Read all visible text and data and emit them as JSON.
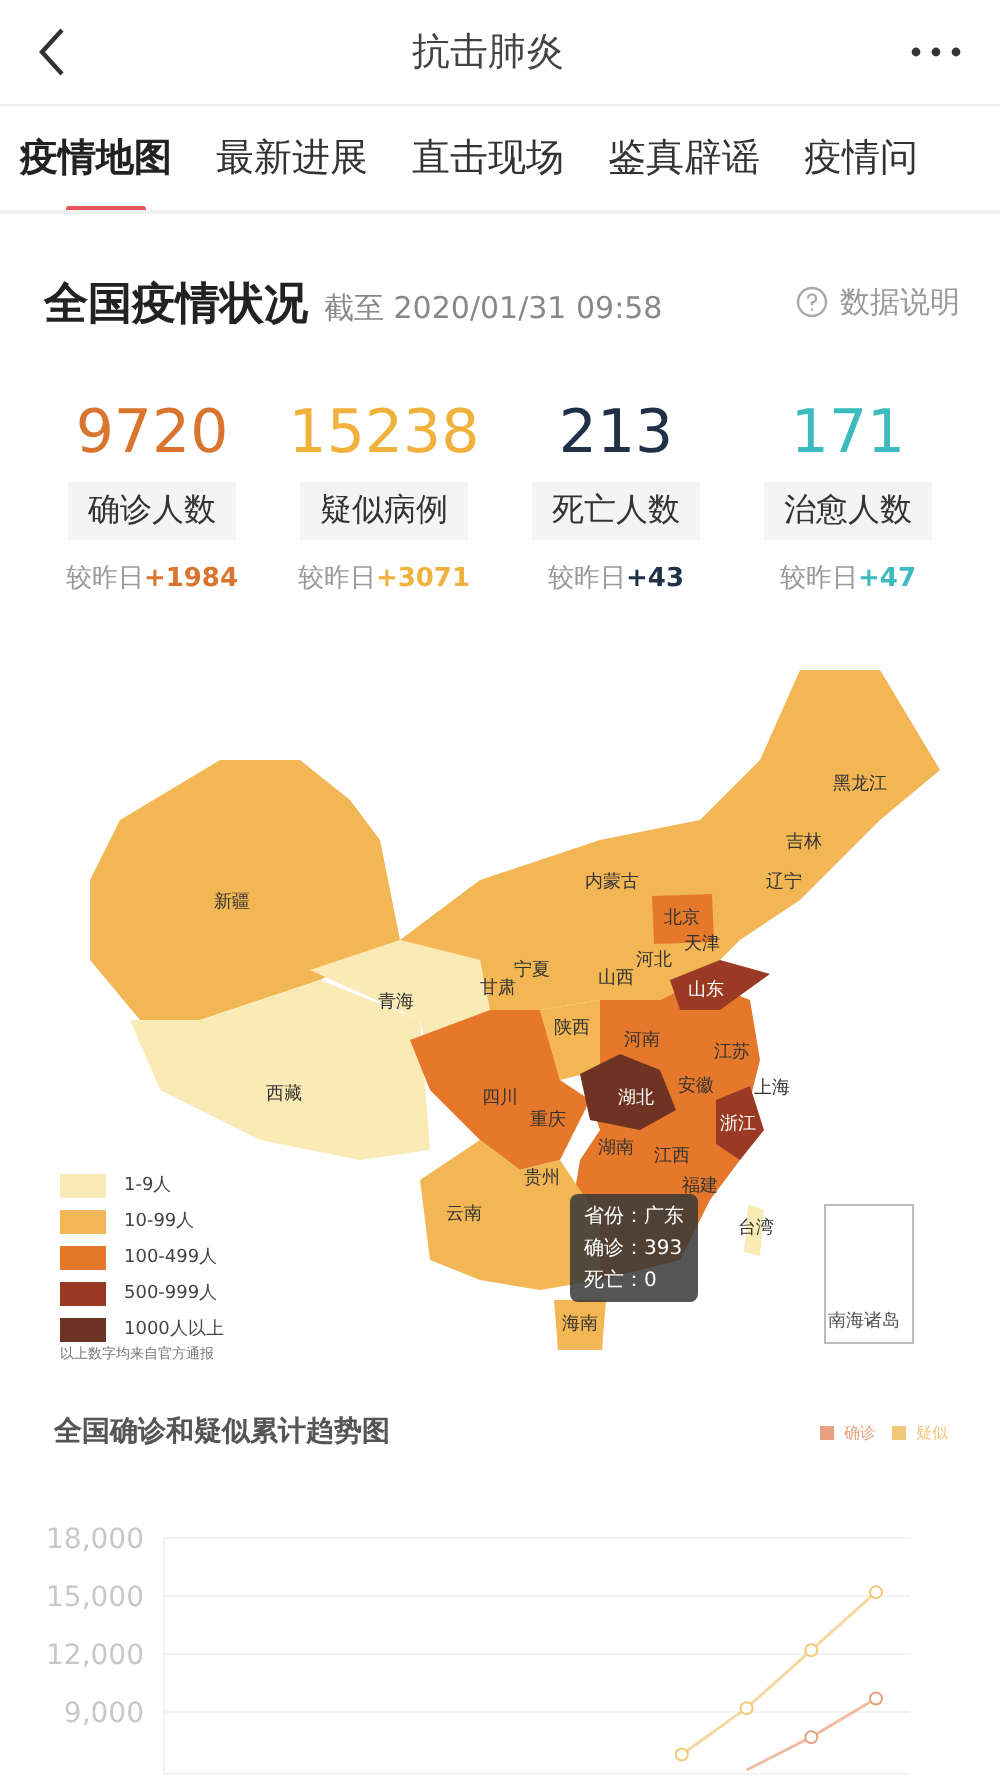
{
  "header": {
    "title": "抗击肺炎"
  },
  "tabs": [
    {
      "label": "疫情地图",
      "selected": true
    },
    {
      "label": "最新进展",
      "selected": false
    },
    {
      "label": "直击现场",
      "selected": false
    },
    {
      "label": "鉴真辟谣",
      "selected": false
    },
    {
      "label": "疫情问",
      "selected": false
    }
  ],
  "overview": {
    "title": "全国疫情状况",
    "timestamp": "截至 2020/01/31 09:58",
    "help_link": "数据说明"
  },
  "stats": [
    {
      "value": "9720",
      "label": "确诊人数",
      "delta_prefix": "较昨日",
      "delta": "+1984",
      "color": "#d9752f"
    },
    {
      "value": "15238",
      "label": "疑似病例",
      "delta_prefix": "较昨日",
      "delta": "+3071",
      "color": "#f0b23c"
    },
    {
      "value": "213",
      "label": "死亡人数",
      "delta_prefix": "较昨日",
      "delta": "+43",
      "color": "#1f3047"
    },
    {
      "value": "171",
      "label": "治愈人数",
      "delta_prefix": "较昨日",
      "delta": "+47",
      "color": "#3cbcbf"
    }
  ],
  "map": {
    "provinces": [
      {
        "label": "黑龙江"
      },
      {
        "label": "吉林"
      },
      {
        "label": "辽宁"
      },
      {
        "label": "内蒙古"
      },
      {
        "label": "新疆"
      },
      {
        "label": "北京"
      },
      {
        "label": "天津"
      },
      {
        "label": "河北"
      },
      {
        "label": "宁夏"
      },
      {
        "label": "山西"
      },
      {
        "label": "山东"
      },
      {
        "label": "青海"
      },
      {
        "label": "甘肃"
      },
      {
        "label": "陕西"
      },
      {
        "label": "河南"
      },
      {
        "label": "江苏"
      },
      {
        "label": "西藏"
      },
      {
        "label": "四川"
      },
      {
        "label": "湖北"
      },
      {
        "label": "安徽"
      },
      {
        "label": "上海"
      },
      {
        "label": "重庆"
      },
      {
        "label": "浙江"
      },
      {
        "label": "湖南"
      },
      {
        "label": "江西"
      },
      {
        "label": "贵州"
      },
      {
        "label": "福建"
      },
      {
        "label": "云南"
      },
      {
        "label": "台湾"
      },
      {
        "label": "海南"
      }
    ],
    "inset_label": "南海诸岛",
    "legend": [
      {
        "label": "1-9人",
        "color": "#faeab5"
      },
      {
        "label": "10-99人",
        "color": "#f2b654"
      },
      {
        "label": "100-499人",
        "color": "#e5782a"
      },
      {
        "label": "500-999人",
        "color": "#9a3a24"
      },
      {
        "label": "1000人以上",
        "color": "#6e3322"
      }
    ],
    "footnote": "以上数字均来自官方通报",
    "tooltip": [
      "省份：广东",
      "确诊：393",
      "死亡：0"
    ]
  },
  "trend": {
    "title": "全国确诊和疑似累计趋势图",
    "chart_data": {
      "type": "line",
      "grid": true,
      "ylim": [
        5800,
        18000
      ],
      "yticks": [
        {
          "value": 9000,
          "label": "9,000"
        },
        {
          "value": 12000,
          "label": "12,000"
        },
        {
          "value": 15000,
          "label": "15,000"
        },
        {
          "value": 18000,
          "label": "18,000"
        }
      ],
      "categories": [
        null,
        null,
        null,
        null,
        null,
        null,
        null,
        null,
        null,
        null,
        null,
        null
      ],
      "series": [
        {
          "name": "确诊",
          "color": "#e8a07e",
          "marker": "circle",
          "values": [
            null,
            null,
            null,
            null,
            null,
            null,
            null,
            null,
            null,
            6000,
            7700,
            9700
          ]
        },
        {
          "name": "疑似",
          "color": "#f0c878",
          "marker": "circle",
          "values": [
            null,
            null,
            null,
            null,
            null,
            null,
            null,
            null,
            6800,
            9200,
            12200,
            15200
          ]
        }
      ]
    }
  }
}
